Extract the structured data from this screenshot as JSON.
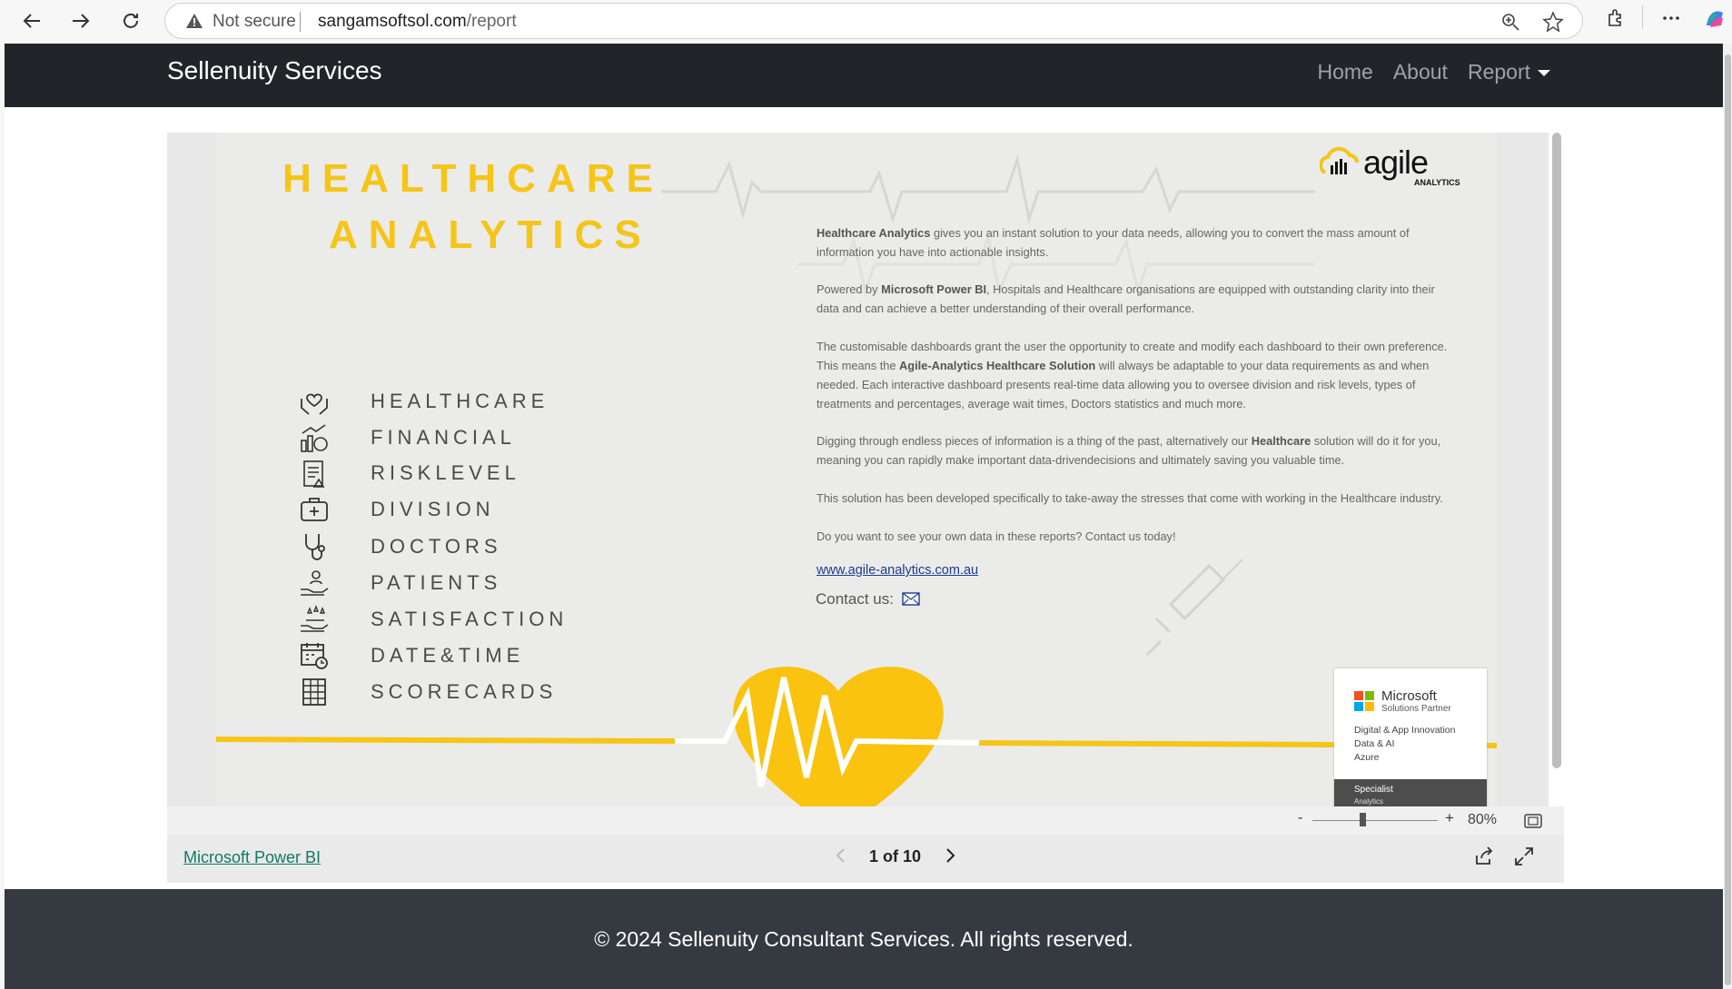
{
  "browser": {
    "security_label": "Not secure",
    "url_host": "sangamsoftsol.com",
    "url_path": "/report"
  },
  "site": {
    "brand": "Sellenuity Services",
    "nav": {
      "home": "Home",
      "about": "About",
      "report": "Report"
    }
  },
  "report": {
    "title_line1": "HEALTHCARE",
    "title_line2": "ANALYTICS",
    "logo_text": "agile",
    "logo_sub": "ANALYTICS",
    "categories": [
      {
        "label": "HEALTHCARE",
        "icon": "heart-hands-icon"
      },
      {
        "label": "FINANCIAL",
        "icon": "money-chart-icon"
      },
      {
        "label": "RISKLEVEL",
        "icon": "clipboard-warning-icon"
      },
      {
        "label": "DIVISION",
        "icon": "medical-kit-icon"
      },
      {
        "label": "DOCTORS",
        "icon": "stethoscope-icon"
      },
      {
        "label": "PATIENTS",
        "icon": "hand-person-icon"
      },
      {
        "label": "SATISFACTION",
        "icon": "hand-stars-icon"
      },
      {
        "label": "DATE&TIME",
        "icon": "calendar-clock-icon"
      },
      {
        "label": "SCORECARDS",
        "icon": "grid-table-icon"
      }
    ],
    "paragraphs": {
      "p1_bold": "Healthcare Analytics",
      "p1_rest": " gives you an instant solution to your data needs, allowing you to convert the mass amount of information you have into actionable insights.",
      "p2_a": "Powered by ",
      "p2_bold": "Microsoft Power BI",
      "p2_rest": ", Hospitals and Healthcare organisations are equipped with outstanding clarity into their data and can achieve a better understanding of their overall performance.",
      "p3_a": "The customisable dashboards grant the user the opportunity to create and modify each dashboard to their own preference. This means the ",
      "p3_bold": "Agile-Analytics Healthcare Solution",
      "p3_rest": " will always be adaptable to your data requirements as and when needed. Each interactive dashboard presents real-time data allowing you to oversee division and risk levels, types of treatments and percentages, average wait times, Doctors statistics and much more.",
      "p4_a": "Digging through endless pieces of information is a thing of the past, alternatively our ",
      "p4_bold": "Healthcare",
      "p4_rest": " solution will do it for you, meaning you can rapidly make important data-drivendecisions and ultimately saving you valuable time.",
      "p5": "This solution has been developed specifically to take-away the stresses that come with working in the Healthcare industry.",
      "p6": "Do you want to see your own data in these reports? Contact us today!"
    },
    "website": "www.agile-analytics.com.au ",
    "contact_label": "Contact us:",
    "badge": {
      "name": "Microsoft",
      "sub": "Solutions Partner",
      "line1": "Digital & App Innovation",
      "line2": "Data & AI",
      "line3": "Azure",
      "specialist": "Specialist",
      "specialist_sub": "Analytics"
    }
  },
  "viewer": {
    "zoom_minus": "-",
    "zoom_plus": "+",
    "zoom_level": 80,
    "zoom_text": "80%",
    "powerbi_link": "Microsoft Power BI",
    "page_indicator": "1 of 10"
  },
  "footer": {
    "copyright": "© 2024 Sellenuity Consultant Services. All rights reserved."
  },
  "colors": {
    "accent_yellow": "#f5c518",
    "navbar": "#212529",
    "footer": "#343a40",
    "powerbi_link": "#117865"
  }
}
